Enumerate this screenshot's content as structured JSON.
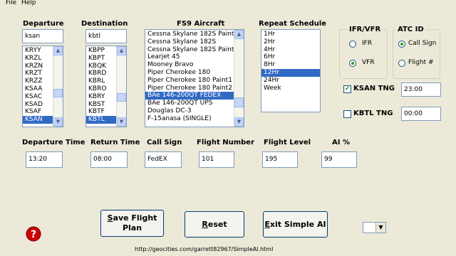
{
  "menu": {
    "file": "File",
    "help": "Help"
  },
  "departure": {
    "label": "Departure",
    "input": "ksan",
    "items": [
      "KRYY",
      "KRZL",
      "KRZN",
      "KRZT",
      "KRZZ",
      "KSAA",
      "KSAC",
      "KSAD",
      "KSAF",
      "KSAN"
    ],
    "selected": "KSAN"
  },
  "destination": {
    "label": "Destination",
    "input": "kbtl",
    "items": [
      "KBPP",
      "KBPT",
      "KBQK",
      "KBRD",
      "KBRL",
      "KBRO",
      "KBRY",
      "KBST",
      "KBTF",
      "KBTL"
    ],
    "selected": "KBTL"
  },
  "aircraft": {
    "label": "FS9 Aircraft",
    "items": [
      "Cessna Skylane 182S Paint3",
      "Cessna Skylane 182S",
      "Cessna Skylane 182S Paint1",
      "Learjet 45",
      "Mooney Bravo",
      "Piper Cherokee 180",
      "Piper Cherokee 180 Paint1",
      "Piper Cherokee 180 Paint2",
      "BAe 146-200QT FEDEX",
      "BAe 146-200QT UPS",
      "Douglas DC-3",
      "F-15anasa (SINGLE)"
    ],
    "selected": "BAe 146-200QT FEDEX"
  },
  "schedule": {
    "label": "Repeat Schedule",
    "items": [
      "1Hr",
      "2Hr",
      "4Hr",
      "6Hr",
      "8Hr",
      "12Hr",
      "24Hr",
      "Week"
    ],
    "selected": "12Hr"
  },
  "ifr_vfr": {
    "label": "IFR/VFR",
    "ifr": "IFR",
    "vfr": "VFR",
    "selected": "VFR"
  },
  "atc_id": {
    "label": "ATC ID",
    "call_sign": "Call Sign",
    "flight_no": "Flight #",
    "selected": "Call Sign"
  },
  "tng1": {
    "label": "KSAN TNG",
    "checked": true,
    "time": "23:00"
  },
  "tng2": {
    "label": "KBTL TNG",
    "checked": false,
    "time": "00:00"
  },
  "fields": {
    "departure_time_label": "Departure Time",
    "departure_time": "13:20",
    "return_time_label": "Return Time",
    "return_time": "08:00",
    "call_sign_label": "Call Sign",
    "call_sign": "FedEX",
    "flight_number_label": "Flight Number",
    "flight_number": "101",
    "flight_level_label": "Flight Level",
    "flight_level": "195",
    "ai_label": "AI %",
    "ai": "99"
  },
  "buttons": {
    "save_line1_s": "S",
    "save_line1_rest": "ave Flight",
    "save_line2": "Plan",
    "reset_r": "R",
    "reset_rest": "eset",
    "exit_e": "E",
    "exit_rest": "xit Simple AI"
  },
  "footer_url": "http://geocities.com/garrett82967/SimpleAI.html",
  "help_icon": "question-icon",
  "colors": {
    "background": "#ece9d8",
    "selection": "#316ac5",
    "help_red": "#cc0000"
  }
}
